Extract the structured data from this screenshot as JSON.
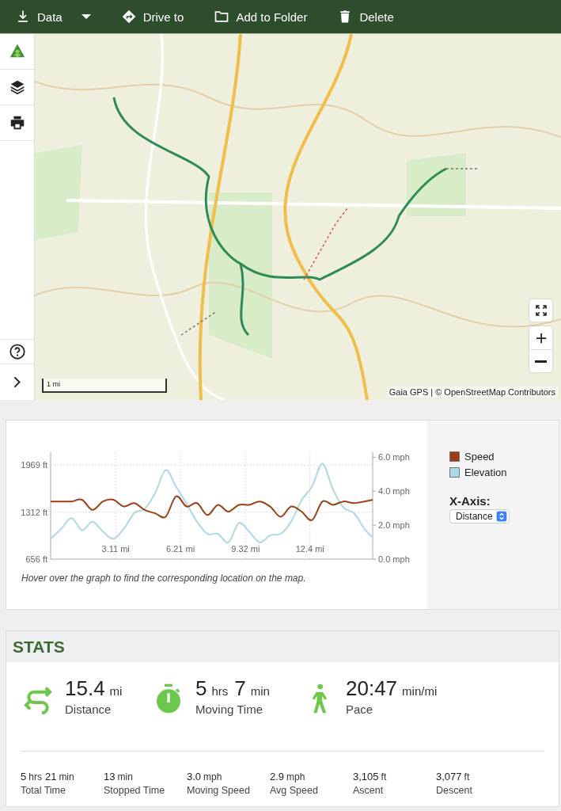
{
  "toolbar": [
    {
      "label": "Data",
      "dropdown": true
    },
    {
      "label": "Drive to",
      "dropdown": false
    },
    {
      "label": "Add to Folder",
      "dropdown": false
    },
    {
      "label": "Delete",
      "dropdown": false
    }
  ],
  "map": {
    "kind": "picture",
    "scale": "1 mi",
    "attribution": "Gaia GPS | © OpenStreetMap Contributors"
  },
  "chart": {
    "caption": "Hover over the graph to find the corresponding location on the map.",
    "x_axis_label": "X-Axis:",
    "x_axis_value": "Distance",
    "chart_data": {
      "type": "line",
      "grid": true,
      "x": [
        0,
        0.5,
        1,
        1.5,
        2,
        2.5,
        3,
        3.5,
        4,
        4.5,
        5,
        5.5,
        6,
        6.5,
        7,
        7.5,
        8,
        8.5,
        9,
        9.5,
        10,
        10.5,
        11,
        11.5,
        12,
        12.5,
        13,
        13.5,
        14,
        14.5,
        15,
        15.4
      ],
      "xlim": [
        0,
        15.4
      ],
      "ylim": [
        656,
        2150
      ],
      "y2lim": [
        0,
        6.3
      ],
      "xticks": [
        {
          "value": 3.11,
          "label": "3.11 mi"
        },
        {
          "value": 6.21,
          "label": "6.21 mi"
        },
        {
          "value": 9.32,
          "label": "9.32 mi"
        },
        {
          "value": 12.4,
          "label": "12.4 mi"
        }
      ],
      "yticks": [
        {
          "value": 656,
          "label": "656 ft"
        },
        {
          "value": 1312,
          "label": "1312 ft"
        },
        {
          "value": 1969,
          "label": "1969 ft"
        }
      ],
      "y2ticks": [
        {
          "value": 0,
          "label": "0.0 mph"
        },
        {
          "value": 2,
          "label": "2.0 mph"
        },
        {
          "value": 4,
          "label": "4.0 mph"
        },
        {
          "value": 6,
          "label": "6.0 mph"
        }
      ],
      "series": [
        {
          "name": "Speed",
          "color": "#9c3f14",
          "axis": "y2",
          "values": [
            3.4,
            3.4,
            3.4,
            3.5,
            2.9,
            3.4,
            3.5,
            3.1,
            3.3,
            2.9,
            2.7,
            2.5,
            3.7,
            3.1,
            3.3,
            2.6,
            3.2,
            2.8,
            3.2,
            3.2,
            3.4,
            3.1,
            2.5,
            3.1,
            2.8,
            2.3,
            3.4,
            3.2,
            3.4,
            3.3,
            3.4,
            3.5
          ]
        },
        {
          "name": "Elevation",
          "color": "#add8e6",
          "values": [
            940,
            1080,
            1230,
            1060,
            1180,
            1040,
            940,
            1080,
            1300,
            1360,
            1580,
            1900,
            1670,
            1430,
            1180,
            1010,
            1010,
            890,
            1160,
            1040,
            890,
            990,
            1010,
            1180,
            1480,
            1670,
            1990,
            1630,
            1380,
            1300,
            1080,
            960
          ]
        }
      ]
    }
  },
  "stats": {
    "title": "STATS",
    "main": [
      {
        "parts": [
          {
            "number": "15.4",
            "unit": "mi"
          }
        ],
        "label": "Distance"
      },
      {
        "parts": [
          {
            "number": "5",
            "unit": "hrs"
          },
          {
            "number": "7",
            "unit": "min"
          }
        ],
        "label": "Moving Time"
      },
      {
        "parts": [
          {
            "number": "20:47",
            "unit": "min/mi"
          }
        ],
        "label": "Pace"
      }
    ],
    "details": [
      {
        "parts": [
          {
            "number": "5",
            "unit": "hrs"
          },
          {
            "number": "21",
            "unit": "min"
          }
        ],
        "label": "Total Time"
      },
      {
        "parts": [
          {
            "number": "13",
            "unit": "min"
          }
        ],
        "label": "Stopped Time"
      },
      {
        "parts": [
          {
            "number": "3.0",
            "unit": "mph"
          }
        ],
        "label": "Moving Speed"
      },
      {
        "parts": [
          {
            "number": "2.9",
            "unit": "mph"
          }
        ],
        "label": "Avg Speed"
      },
      {
        "parts": [
          {
            "number": "3,105",
            "unit": "ft"
          }
        ],
        "label": "Ascent"
      },
      {
        "parts": [
          {
            "number": "3,077",
            "unit": "ft"
          }
        ],
        "label": "Descent"
      }
    ]
  }
}
